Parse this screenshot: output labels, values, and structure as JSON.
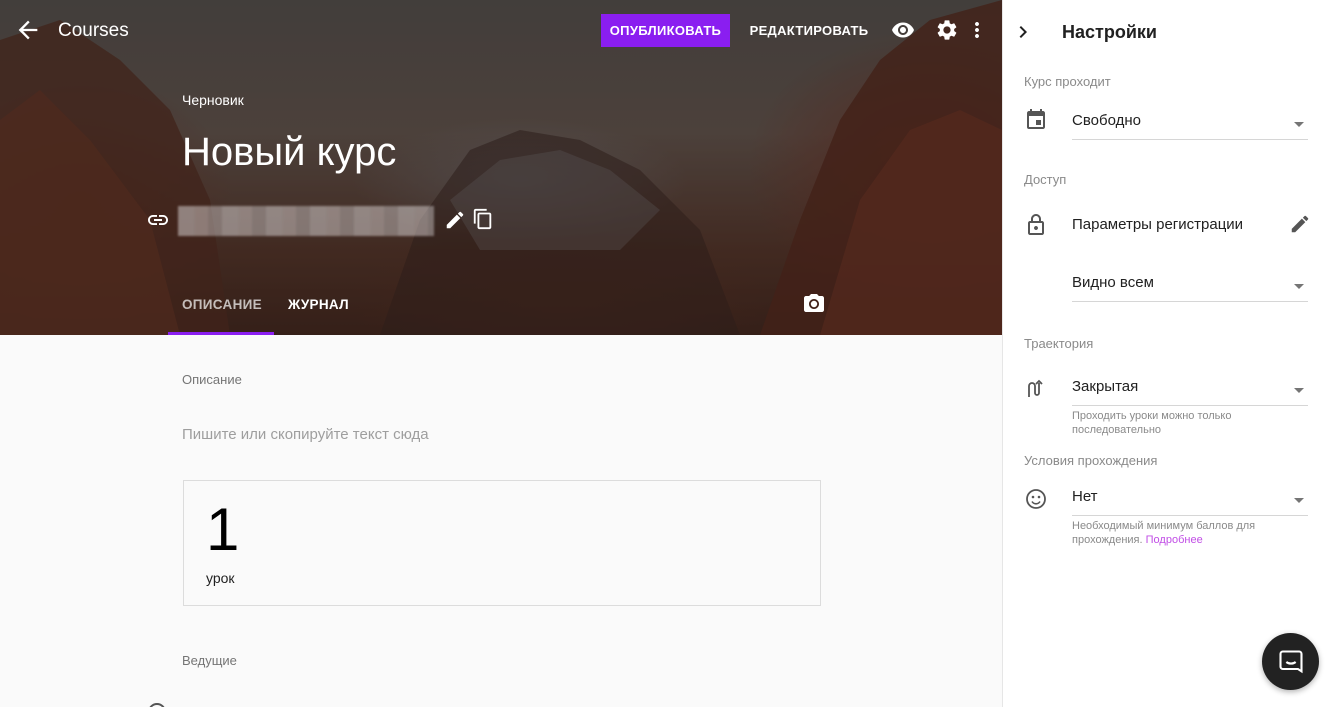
{
  "header": {
    "app_title": "Courses",
    "publish_label": "ОПУБЛИКОВАТЬ",
    "edit_label": "РЕДАКТИРОВАТЬ",
    "icons": [
      "arrow-back-icon",
      "eye-icon",
      "gear-icon",
      "more-vert-icon"
    ]
  },
  "course": {
    "status": "Черновик",
    "title": "Новый курс",
    "link_icon": "link-icon"
  },
  "tabs": [
    {
      "label": "ОПИСАНИЕ",
      "active": true
    },
    {
      "label": "ЖУРНАЛ",
      "active": false
    }
  ],
  "content": {
    "description_label": "Описание",
    "description_placeholder": "Пишите или скопируйте текст сюда",
    "lessons_count": "1",
    "lessons_word": "урок",
    "hosts_label": "Ведущие"
  },
  "settings": {
    "title": "Настройки",
    "pace": {
      "section": "Курс проходит",
      "value": "Свободно"
    },
    "access": {
      "section": "Доступ",
      "registration_label": "Параметры регистрации",
      "visibility_value": "Видно всем"
    },
    "trajectory": {
      "section": "Траектория",
      "value": "Закрытая",
      "hint": "Проходить уроки можно только последовательно"
    },
    "completion": {
      "section": "Условия прохождения",
      "value": "Нет",
      "hint": "Необходимый минимум баллов для прохождения.",
      "link": "Подробнее"
    }
  },
  "colors": {
    "accent": "#8a1ef0",
    "link": "#c14ee6",
    "fab": "#222222"
  }
}
